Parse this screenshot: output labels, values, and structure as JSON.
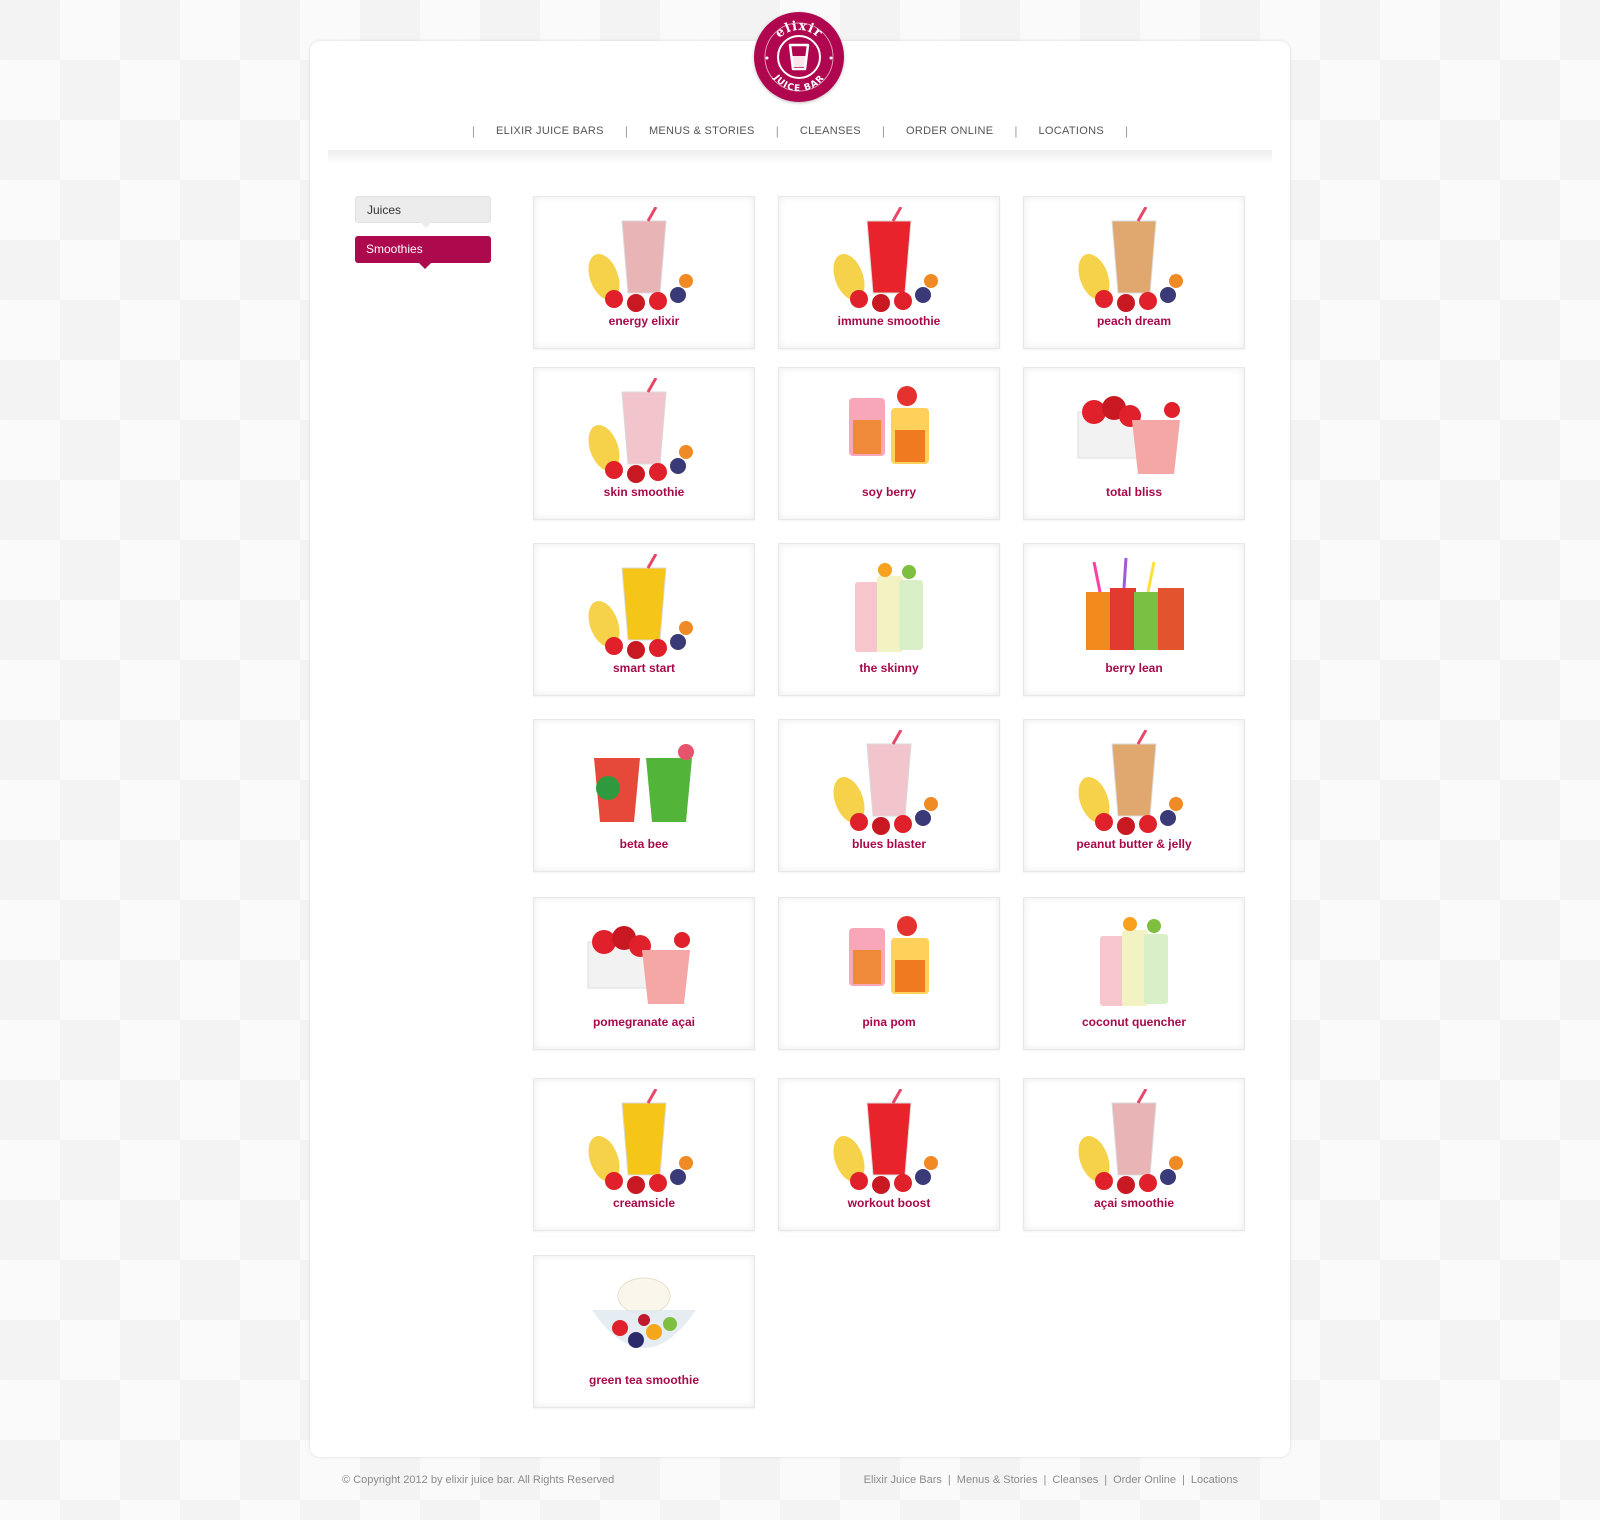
{
  "logo": {
    "top_text": "elixir",
    "bottom_text": "JUICE BAR",
    "color": "#b0064f"
  },
  "nav": {
    "items": [
      "ELIXIR JUICE BARS",
      "MENUS & STORIES",
      "CLEANSES",
      "ORDER ONLINE",
      "LOCATIONS"
    ]
  },
  "sidebar": {
    "tabs": [
      {
        "label": "Juices",
        "active": false
      },
      {
        "label": "Smoothies",
        "active": true
      }
    ]
  },
  "products": [
    {
      "name": "energy elixir",
      "drink": "#e8b4b6",
      "icon": "smoothie-glass-with-banana-berries"
    },
    {
      "name": "immune smoothie",
      "drink": "#e8232c",
      "icon": "red-smoothie-with-strawberries"
    },
    {
      "name": "peach dream",
      "drink": "#e0a86f",
      "icon": "peach-smoothie-with-peaches"
    },
    {
      "name": "skin smoothie",
      "drink": "#f2c4cc",
      "icon": "pink-smoothie-with-banana-strawberries"
    },
    {
      "name": "soy berry",
      "drink": "#ef8a3a",
      "icon": "two-fruit-cups"
    },
    {
      "name": "total bliss",
      "drink": "#f4a7a4",
      "icon": "strawberries-and-pink-smoothie"
    },
    {
      "name": "smart start",
      "drink": "#f5c518",
      "icon": "yellow-smoothie-with-fruit"
    },
    {
      "name": "the skinny",
      "drink": "#eef0b4",
      "icon": "three-light-smoothies"
    },
    {
      "name": "berry lean",
      "drink": "#e23a2e",
      "icon": "four-colored-smoothies"
    },
    {
      "name": "beta bee",
      "drink": "#e6493a",
      "icon": "red-and-green-juices"
    },
    {
      "name": "blues blaster",
      "drink": "#f2c4cc",
      "icon": "pink-smoothie-with-banana-strawberries"
    },
    {
      "name": "peanut butter & jelly",
      "drink": "#e0a86f",
      "icon": "peach-smoothie-with-peaches"
    },
    {
      "name": "pomegranate açai",
      "drink": "#f4a7a4",
      "icon": "strawberries-and-pink-smoothie"
    },
    {
      "name": "pina pom",
      "drink": "#ef8a3a",
      "icon": "two-fruit-cups"
    },
    {
      "name": "coconut quencher",
      "drink": "#eef0b4",
      "icon": "three-light-smoothies"
    },
    {
      "name": "creamsicle",
      "drink": "#f5c518",
      "icon": "yellow-smoothie-with-fruit"
    },
    {
      "name": "workout boost",
      "drink": "#e8232c",
      "icon": "red-smoothie-with-strawberries"
    },
    {
      "name": "açai smoothie",
      "drink": "#e8b4b6",
      "icon": "smoothie-glass-with-banana-berries"
    },
    {
      "name": "green tea smoothie",
      "drink": "#f6f0e4",
      "icon": "fruit-bowl-with-frozen-yogurt"
    }
  ],
  "footer": {
    "copyright": "© Copyright 2012 by elixir juice bar. All Rights Reserved",
    "links": [
      "Elixir Juice Bars",
      "Menus & Stories",
      "Cleanses",
      "Order Online",
      "Locations"
    ]
  },
  "colors": {
    "accent": "#ad0a4d",
    "label": "#a8094a"
  }
}
